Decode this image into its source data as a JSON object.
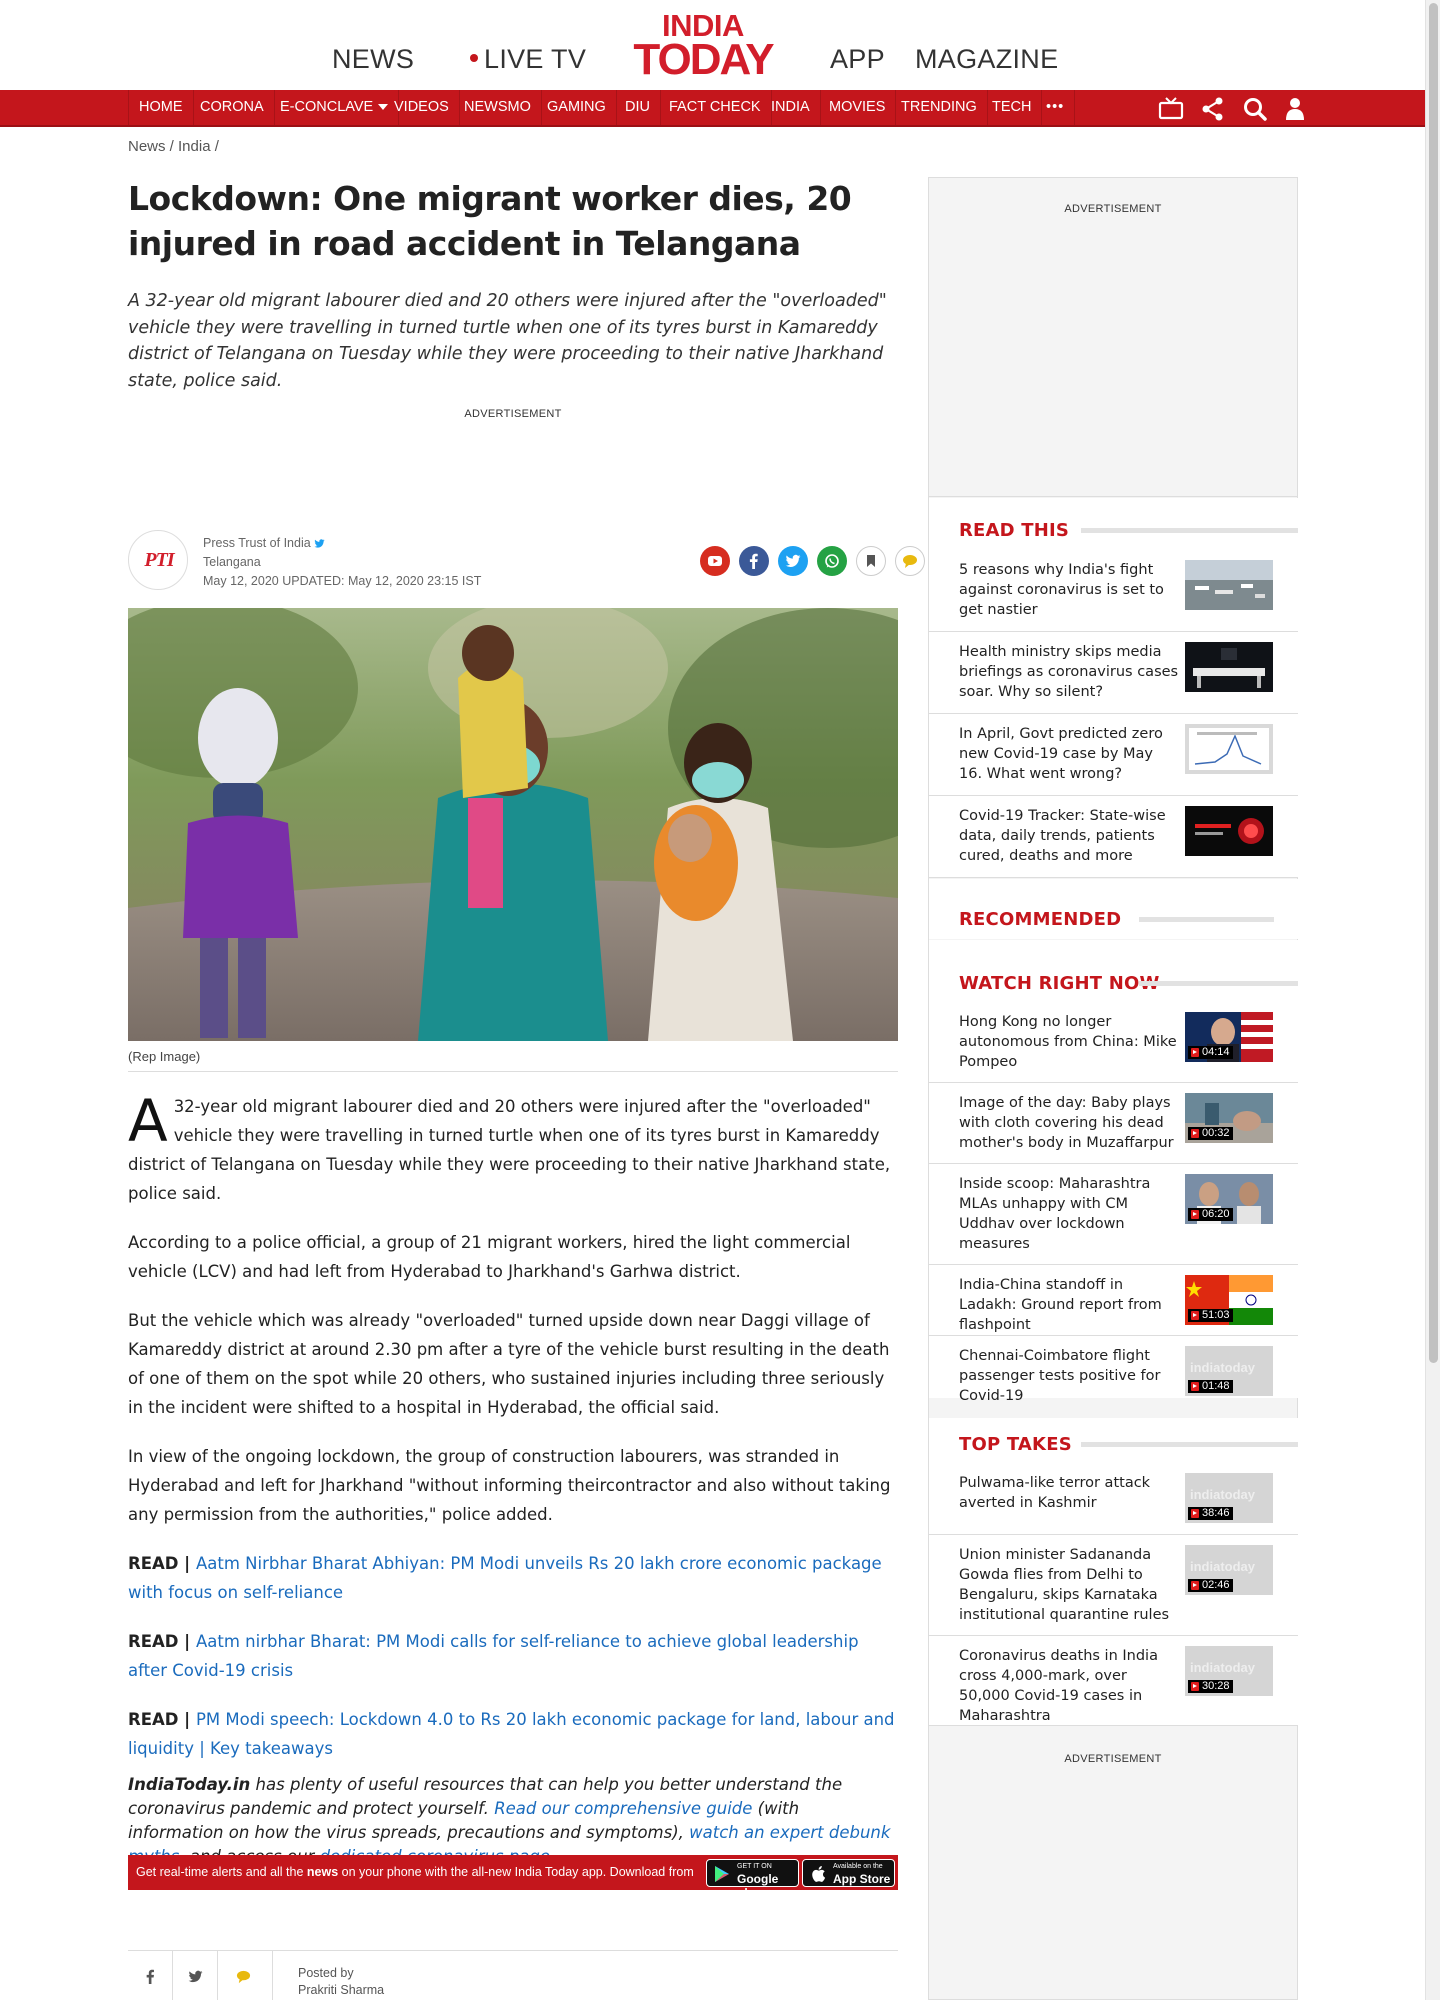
{
  "header": {
    "links": {
      "news": "NEWS",
      "live_tv": "LIVE TV",
      "app": "APP",
      "magazine": "MAGAZINE"
    },
    "logo": {
      "line1": "INDIA",
      "line2": "TODAY"
    },
    "accent": "#c4161c"
  },
  "nav": {
    "items": [
      "HOME",
      "CORONA",
      "E-CONCLAVE",
      "VIDEOS",
      "NEWSMO",
      "GAMING",
      "DIU",
      "FACT CHECK",
      "INDIA",
      "MOVIES",
      "TRENDING",
      "TECH"
    ],
    "more": "•••",
    "icons": [
      "tv-icon",
      "share-icon",
      "search-icon",
      "user-icon"
    ]
  },
  "breadcrumb": "News / India /",
  "article": {
    "headline": "Lockdown: One migrant worker dies, 20 injured in road accident in Telangana",
    "standfirst": "A 32-year old migrant labourer died and 20 others were injured after the \"overloaded\" vehicle they were travelling in turned turtle when one of its tyres burst in Kamareddy district of Telangana on Tuesday while they were proceeding to their native Jharkhand state, police said.",
    "ad_label": "ADVERTISEMENT",
    "byline": {
      "logo_text": "PTI",
      "source": "Press Trust of India",
      "location": "Telangana",
      "dates": "May 12, 2020  UPDATED: May 12, 2020 23:15 IST"
    },
    "share_icons": [
      "youtube-icon",
      "facebook-icon",
      "twitter-icon",
      "whatsapp-icon",
      "bookmark-icon",
      "comment-icon"
    ],
    "image_caption": "(Rep Image)",
    "dropcap": "A",
    "paragraphs": [
      " 32-year old migrant labourer died and 20 others were injured after the \"overloaded\" vehicle they were travelling in turned turtle when one of its tyres burst in Kamareddy district of Telangana on Tuesday while they were proceeding to their native Jharkhand state, police said.",
      "According to a police official, a group of 21 migrant workers, hired the light commercial vehicle (LCV) and had left from Hyderabad to Jharkhand's Garhwa district.",
      "But the vehicle which was already \"overloaded\" turned upside down near Daggi village of Kamareddy district at around 2.30 pm after a tyre of the vehicle burst resulting in the death of one of them on the spot while 20 others, who sustained injuries including three seriously in the incident were shifted to a hospital in Hyderabad, the official said.",
      "In view of the ongoing lockdown, the group of construction labourers, was stranded in Hyderabad and left for Jharkhand \"without informing theircontractor and also without taking any permission from the authorities,\" police added."
    ],
    "read_prefix": "READ | ",
    "read_links": [
      "Aatm Nirbhar Bharat Abhiyan: PM Modi unveils Rs 20 lakh crore economic package with focus on self-reliance",
      "Aatm nirbhar Bharat: PM Modi calls for self-reliance to achieve global leadership after Covid-19 crisis",
      "PM Modi speech: Lockdown 4.0 to Rs 20 lakh economic package for land, labour and liquidity | Key takeaways"
    ],
    "resource": {
      "brand": "IndiaToday.in",
      "t1": " has plenty of useful resources that can help you better understand the coronavirus pandemic and protect yourself. ",
      "link1": "Read our comprehensive guide",
      "t2": " (with information on how the virus spreads, precautions and symptoms), ",
      "link2": "watch an expert debunk myths",
      "t3": ", and access our ",
      "link3": "dedicated coronavirus page",
      "t4": "."
    },
    "app_banner": {
      "pre": "Get real-time alerts and all the ",
      "bold": "news",
      "post": " on your phone with the all-new India Today app. Download from",
      "google_small": "GET IT ON",
      "google_big": "Google play",
      "apple_small": "Available on the",
      "apple_big": "App Store"
    },
    "posted_by_label": "Posted by",
    "posted_by_name": "Prakriti Sharma"
  },
  "sidebar": {
    "ad_label": "ADVERTISEMENT",
    "read_this": {
      "title": "READ THIS",
      "items": [
        "5 reasons why India's fight against coronavirus is set to get nastier",
        "Health ministry skips media briefings as coronavirus cases soar. Why so silent?",
        "In April, Govt predicted zero new Covid-19 case by May 16. What went wrong?",
        "Covid-19 Tracker: State-wise data, daily trends, patients cured, deaths and more"
      ]
    },
    "recommended": {
      "title": "RECOMMENDED"
    },
    "watch": {
      "title": "WATCH RIGHT NOW",
      "items": [
        {
          "title": "Hong Kong no longer autonomous from China: Mike Pompeo",
          "duration": "04:14"
        },
        {
          "title": "Image of the day: Baby plays with cloth covering his dead mother's body in Muzaffarpur",
          "duration": "00:32"
        },
        {
          "title": "Inside scoop: Maharashtra MLAs unhappy with CM Uddhav over lockdown measures",
          "duration": "06:20"
        },
        {
          "title": "India-China standoff in Ladakh: Ground report from flashpoint",
          "duration": "51:03"
        },
        {
          "title": "Chennai-Coimbatore flight passenger tests positive for Covid-19",
          "duration": "01:48"
        }
      ]
    },
    "top_takes": {
      "title": "TOP TAKES",
      "items": [
        {
          "title": "Pulwama-like terror attack averted in Kashmir",
          "duration": "38:46"
        },
        {
          "title": "Union minister Sadananda Gowda flies from Delhi to Bengaluru, skips Karnataka institutional quarantine rules",
          "duration": "02:46"
        },
        {
          "title": "Coronavirus deaths in India cross 4,000-mark, over 50,000 Covid-19 cases in Maharashtra",
          "duration": "30:28"
        }
      ]
    },
    "watermark": "indiatoday",
    "bottom_ad_label": "ADVERTISEMENT"
  }
}
